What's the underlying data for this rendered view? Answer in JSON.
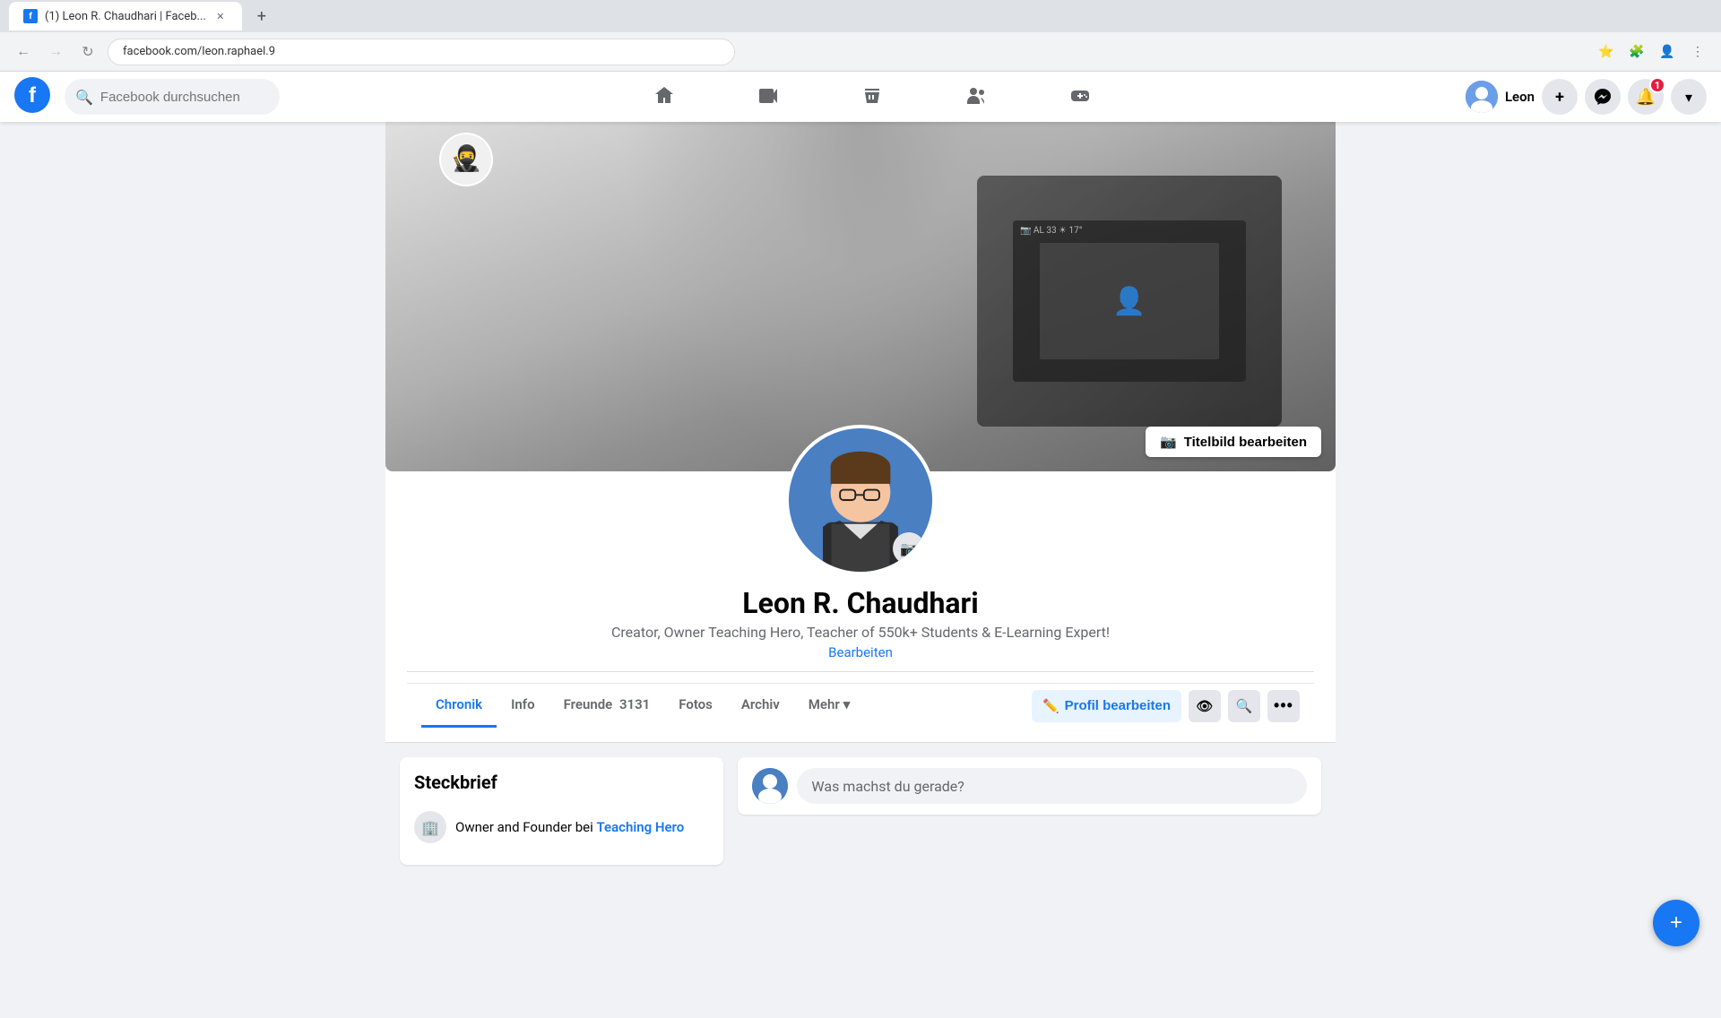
{
  "browser": {
    "tab_title": "(1) Leon R. Chaudhari | Faceb...",
    "favicon": "f",
    "url": "facebook.com/leon.raphael.9",
    "nav_back": "←",
    "nav_forward": "→",
    "nav_refresh": "↻"
  },
  "navbar": {
    "search_placeholder": "Facebook durchsuchen",
    "user_name": "Leon",
    "notification_count": "1",
    "plus_label": "+",
    "home_icon": "🏠",
    "watch_icon": "▶",
    "marketplace_icon": "🏪",
    "groups_icon": "👥",
    "gaming_icon": "🎮"
  },
  "profile": {
    "name": "Leon R. Chaudhari",
    "bio": "Creator, Owner Teaching Hero, Teacher of 550k+ Students & E-Learning Expert!",
    "edit_link": "Bearbeiten",
    "edit_cover_btn": "Titelbild bearbeiten",
    "tabs": [
      {
        "label": "Chronik",
        "active": true
      },
      {
        "label": "Info",
        "active": false
      },
      {
        "label": "Freunde",
        "active": false,
        "count": "3131"
      },
      {
        "label": "Fotos",
        "active": false
      },
      {
        "label": "Archiv",
        "active": false
      },
      {
        "label": "Mehr",
        "active": false,
        "has_arrow": true
      }
    ],
    "action_buttons": {
      "edit_profile": "Profil bearbeiten"
    },
    "steckbrief": {
      "title": "Steckbrief",
      "items": [
        {
          "text": "Owner and Founder bei ",
          "link": "Teaching Hero"
        }
      ]
    }
  },
  "composer": {
    "placeholder": "Was machst du gerade?"
  },
  "icons": {
    "search": "🔍",
    "camera": "📷",
    "pencil": "✏️",
    "eye": "👁",
    "search_small": "🔍",
    "more": "•••",
    "building": "🏢",
    "messenger": "💬",
    "bell": "🔔",
    "chevron": "▾",
    "plus": "+"
  }
}
